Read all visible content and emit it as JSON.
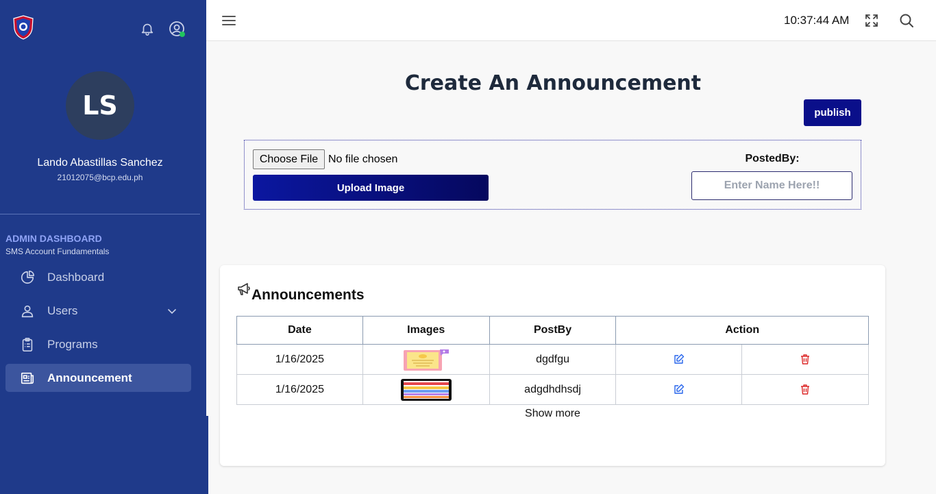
{
  "sidebar": {
    "user": {
      "initials": "LS",
      "name": "Lando Abastillas Sanchez",
      "email": "21012075@bcp.edu.ph"
    },
    "section_title": "ADMIN DASHBOARD",
    "section_subtitle": "SMS Account Fundamentals",
    "nav": [
      {
        "label": "Dashboard",
        "icon": "pie-chart-icon"
      },
      {
        "label": "Users",
        "icon": "user-icon"
      },
      {
        "label": "Programs",
        "icon": "clipboard-icon"
      },
      {
        "label": "Announcement",
        "icon": "newspaper-icon",
        "active": true
      }
    ]
  },
  "topbar": {
    "time": "10:37:44 AM"
  },
  "create": {
    "title": "Create An Announcement",
    "publish_label": "publish",
    "choose_file_label": "Choose File",
    "no_file_text": "No file chosen",
    "upload_label": "Upload Image",
    "posted_by_label": "PostedBy:",
    "name_placeholder": "Enter Name Here!!"
  },
  "announcements": {
    "title": "Announcements",
    "columns": [
      "Date",
      "Images",
      "PostBy",
      "Action"
    ],
    "rows": [
      {
        "date": "1/16/2025",
        "post_by": "dgdfgu"
      },
      {
        "date": "1/16/2025",
        "post_by": "adgdhdhsdj"
      }
    ],
    "show_more": "Show more"
  },
  "colors": {
    "sidebar_bg": "#1f3a8a",
    "primary_button": "#0a0f8a",
    "edit_icon": "#2563eb",
    "delete_icon": "#dc2626"
  }
}
